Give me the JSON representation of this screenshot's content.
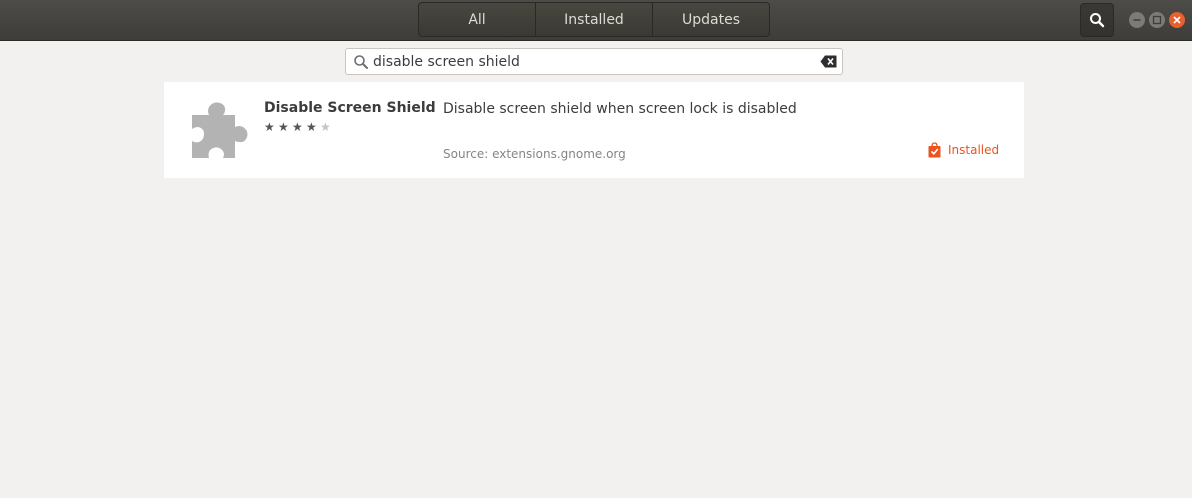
{
  "header": {
    "tabs": [
      {
        "label": "All"
      },
      {
        "label": "Installed"
      },
      {
        "label": "Updates"
      }
    ],
    "search_toggle_icon": "search-icon",
    "window_controls": [
      "minimize-icon",
      "maximize-icon",
      "close-icon"
    ]
  },
  "search": {
    "value": "disable screen shield",
    "icons": {
      "leading": "search-icon",
      "trailing": "clear-icon"
    }
  },
  "results": [
    {
      "name": "Disable Screen Shield",
      "rating": 4,
      "rating_max": 5,
      "summary": "Disable screen shield when screen lock is disabled",
      "source": "Source: extensions.gnome.org",
      "status": "Installed",
      "icon": "puzzle-piece-icon"
    }
  ],
  "colors": {
    "accent": "#e95420",
    "headerbar": "#45443f",
    "background": "#f2f1f0"
  }
}
